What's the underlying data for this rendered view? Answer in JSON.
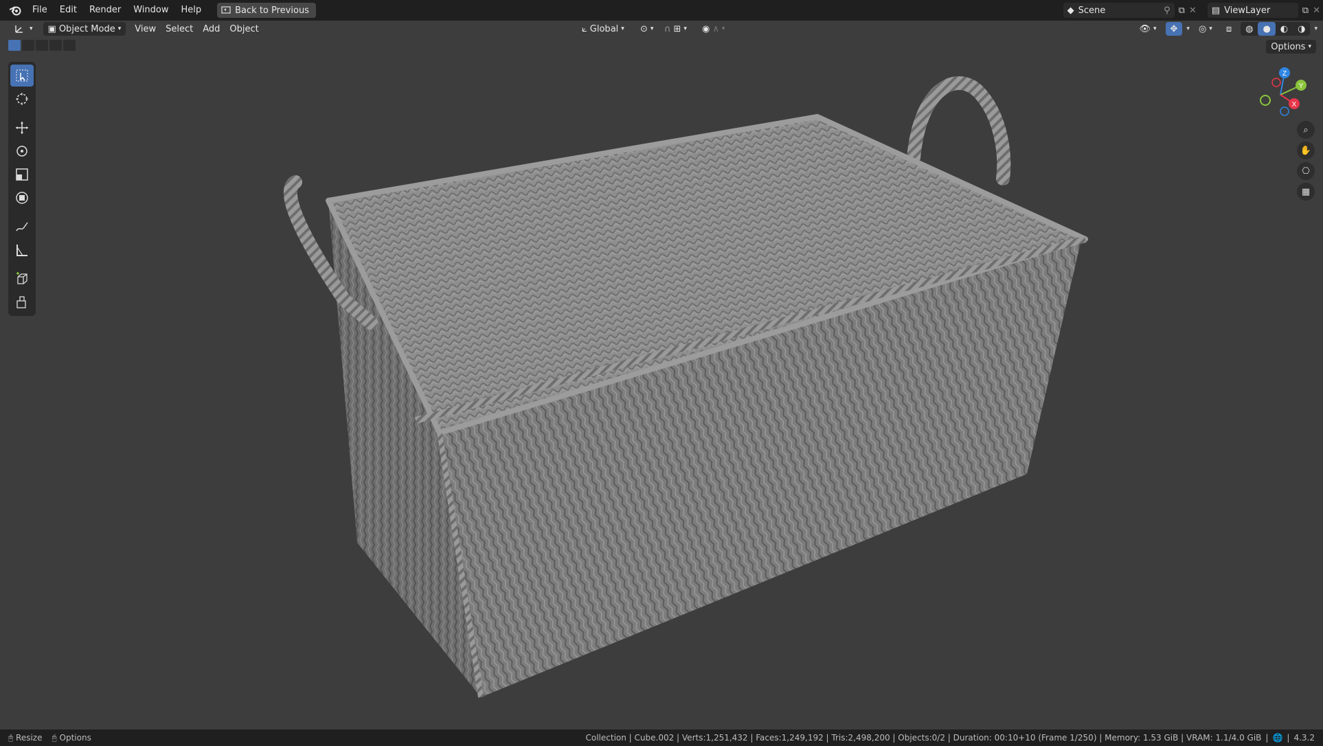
{
  "menu": {
    "file": "File",
    "edit": "Edit",
    "render": "Render",
    "window": "Window",
    "help": "Help",
    "back": "Back to Previous"
  },
  "top_right": {
    "scene": "Scene",
    "view_layer": "ViewLayer"
  },
  "viewport_header": {
    "mode": "Object Mode",
    "view": "View",
    "select": "Select",
    "add": "Add",
    "object": "Object",
    "orientation": "Global",
    "options": "Options"
  },
  "gizmo": {
    "z": "Z",
    "y": "Y",
    "x": "X"
  },
  "status": {
    "resize": "Resize",
    "options": "Options",
    "info": "Collection | Cube.002 | Verts:1,251,432 | Faces:1,249,192 | Tris:2,498,200 | Objects:0/2 | Duration: 00:10+10 (Frame 1/250) | Memory: 1.53 GiB | VRAM: 1.1/4.0 GiB",
    "version": "4.3.2"
  },
  "colors": {
    "accent": "#4772b3",
    "viewport_bg": "#3d3d3d",
    "axis_x": "#e8364b",
    "axis_y": "#8bc43c",
    "axis_z": "#2f86e4"
  }
}
